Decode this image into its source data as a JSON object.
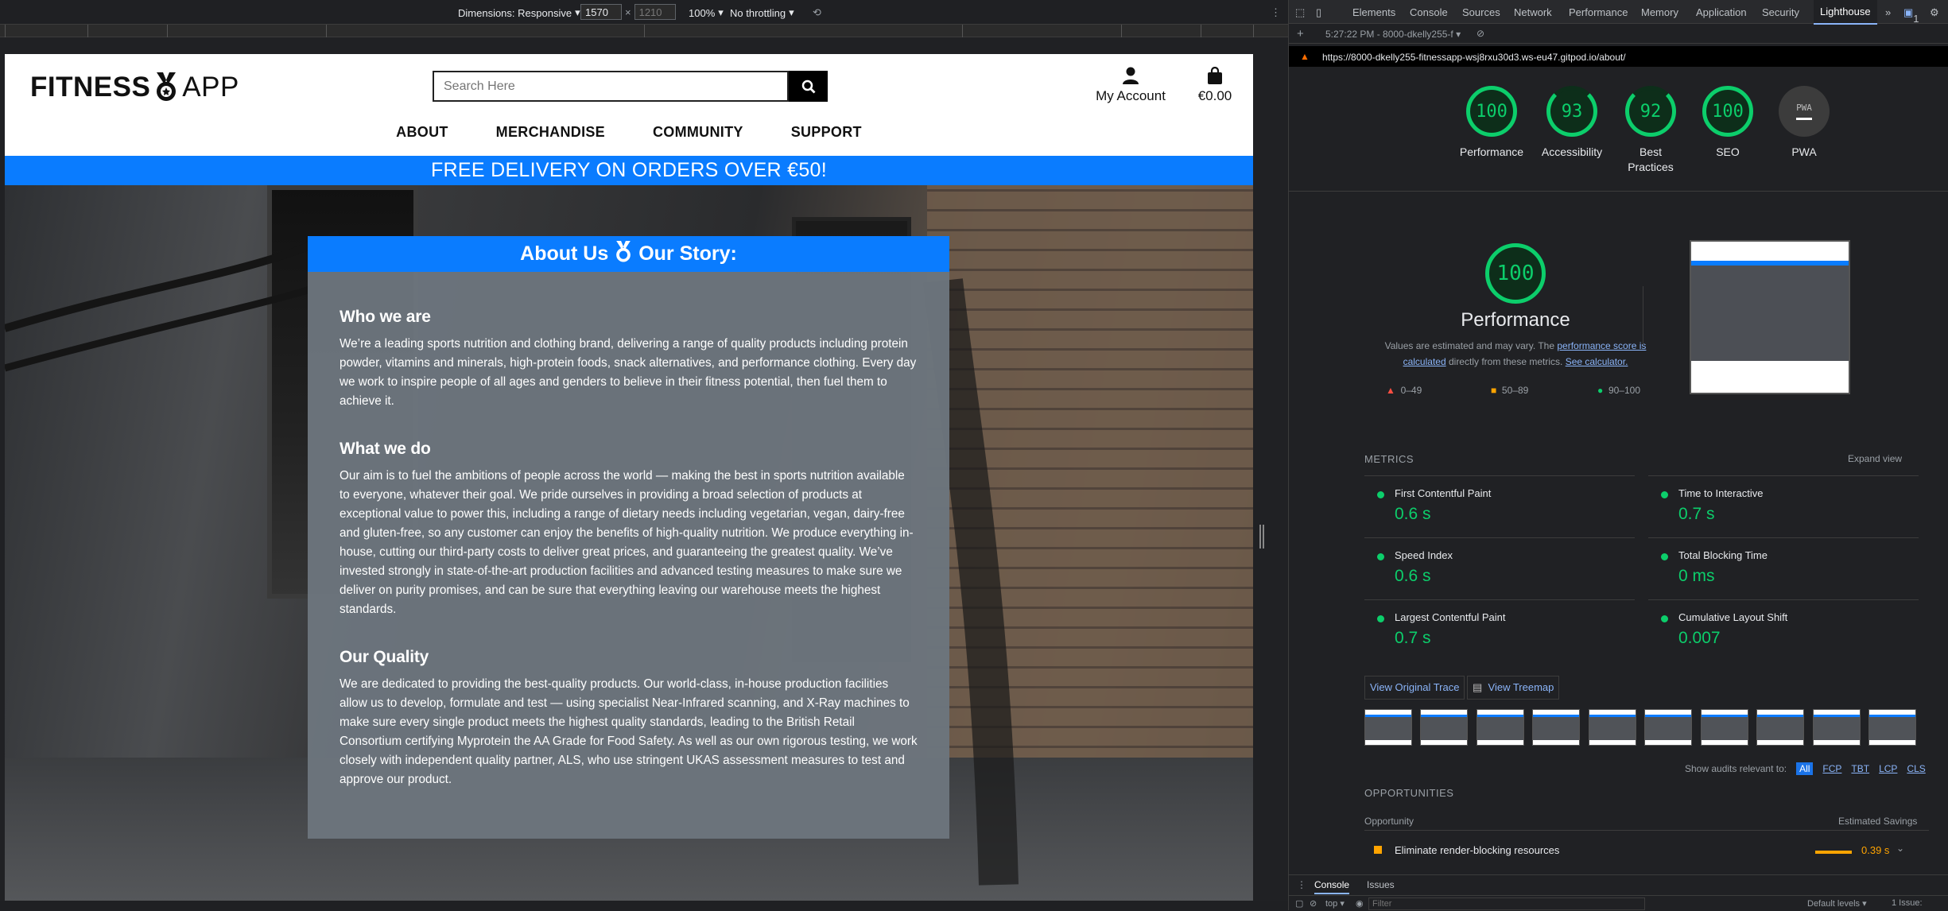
{
  "devicebar": {
    "dimensions": "Dimensions: Responsive",
    "width": "1570",
    "height": "1210",
    "zoom": "100%",
    "throttle": "No throttling"
  },
  "site": {
    "logo_left": "FITNESS",
    "logo_right": "APP",
    "search_placeholder": "Search Here",
    "account": "My Account",
    "cart": "€0.00",
    "nav": [
      "ABOUT",
      "MERCHANDISE",
      "COMMUNITY",
      "SUPPORT"
    ],
    "banner": "FREE DELIVERY ON ORDERS OVER €50!",
    "card_title_left": "About Us",
    "card_title_right": "Our Story:",
    "sections": [
      {
        "heading": "Who we are",
        "text": "We’re a leading sports nutrition and clothing brand, delivering a range of quality products including protein powder, vitamins and minerals, high-protein foods, snack alternatives, and performance clothing. Every day we work to inspire people of all ages and genders to believe in their fitness potential, then fuel them to achieve it."
      },
      {
        "heading": "What we do",
        "text": "Our aim is to fuel the ambitions of people across the world — making the best in sports nutrition available to everyone, whatever their goal. We pride ourselves in providing a broad selection of products at exceptional value to power this, including a range of dietary needs including vegetarian, vegan, dairy-free and gluten-free, so any customer can enjoy the benefits of high-quality nutrition. We produce everything in-house, cutting our third-party costs to deliver great prices, and guaranteeing the greatest quality. We’ve invested strongly in state-of-the-art production facilities and advanced testing measures to make sure we deliver on purity promises, and can be sure that everything leaving our warehouse meets the highest standards."
      },
      {
        "heading": "Our Quality",
        "text": "We are dedicated to providing the best-quality products. Our world-class, in-house production facilities allow us to develop, formulate and test — using specialist Near-Infrared scanning, and X-Ray machines to make sure every single product meets the highest quality standards, leading to the British Retail Consortium certifying Myprotein the AA Grade for Food Safety. As well as our own rigorous testing, we work closely with independent quality partner, ALS, who use stringent UKAS assessment measures to test and approve our product."
      }
    ]
  },
  "devtools": {
    "tabs": [
      "Elements",
      "Console",
      "Sources",
      "Network",
      "Performance",
      "Memory",
      "Application",
      "Security",
      "Lighthouse"
    ],
    "issues_badge": "1",
    "report_time": "5:27:22 PM - 8000-dkelly255-f",
    "url": "https://8000-dkelly255-fitnessapp-wsj8rxu30d3.ws-eu47.gitpod.io/about/",
    "scores": [
      {
        "label": "Performance",
        "value": "100"
      },
      {
        "label": "Accessibility",
        "value": "93"
      },
      {
        "label": "Best Practices",
        "value": "92"
      },
      {
        "label": "SEO",
        "value": "100"
      },
      {
        "label": "PWA",
        "value": "PWA"
      }
    ],
    "perf_title": "Performance",
    "perf_score": "100",
    "note_pre": "Values are estimated and may vary. The ",
    "note_link1": "performance score is calculated",
    "note_mid": " directly from these metrics. ",
    "note_link2": "See calculator.",
    "legend": [
      "0–49",
      "50–89",
      "90–100"
    ],
    "metrics_title": "METRICS",
    "expand": "Expand view",
    "metrics": [
      {
        "name": "First Contentful Paint",
        "value": "0.6 s"
      },
      {
        "name": "Time to Interactive",
        "value": "0.7 s"
      },
      {
        "name": "Speed Index",
        "value": "0.6 s"
      },
      {
        "name": "Total Blocking Time",
        "value": "0 ms"
      },
      {
        "name": "Largest Contentful Paint",
        "value": "0.7 s"
      },
      {
        "name": "Cumulative Layout Shift",
        "value": "0.007"
      }
    ],
    "view_trace": "View Original Trace",
    "view_treemap": "View Treemap",
    "show_audits": "Show audits relevant to:",
    "audit_filters": [
      "All",
      "FCP",
      "TBT",
      "LCP",
      "CLS"
    ],
    "opportunities": "OPPORTUNITIES",
    "opp_col": "Opportunity",
    "savings_col": "Estimated Savings",
    "opp_item": "Eliminate render-blocking resources",
    "opp_value": "0.39 s",
    "drawer_tabs": [
      "Console",
      "Issues"
    ],
    "console_context": "top",
    "filter_placeholder": "Filter",
    "levels": "Default levels",
    "issue_count": "1 Issue:"
  },
  "colors": {
    "accent": "#0a7cff",
    "pass": "#0cce6b",
    "average": "#ffa400",
    "fail": "#ff4e42"
  }
}
